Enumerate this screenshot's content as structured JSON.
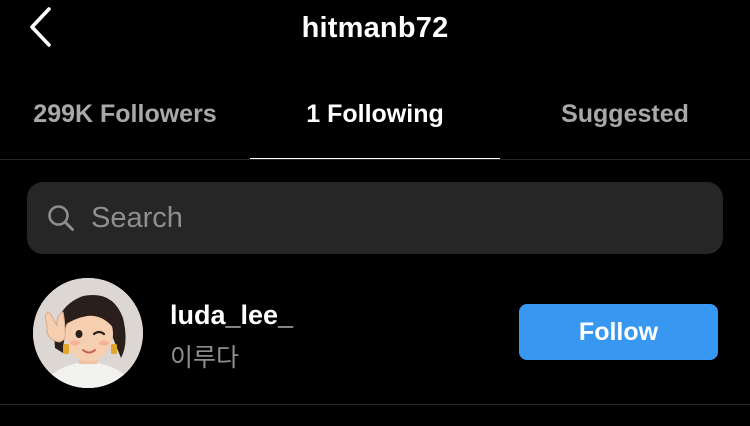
{
  "header": {
    "title": "hitmanb72",
    "back_icon": "chevron-left-icon"
  },
  "tabs": [
    {
      "label": "299K Followers",
      "active": false
    },
    {
      "label": "1 Following",
      "active": true
    },
    {
      "label": "Suggested",
      "active": false
    }
  ],
  "search": {
    "placeholder": "Search",
    "value": "",
    "icon": "search-icon"
  },
  "list": [
    {
      "username": "luda_lee_",
      "full_name": "이루다",
      "button_label": "Follow",
      "button_color": "#3897f0"
    }
  ],
  "colors": {
    "background": "#000000",
    "secondary_text": "#8e8e8e",
    "search_bg": "#262626",
    "accent": "#3897f0"
  }
}
